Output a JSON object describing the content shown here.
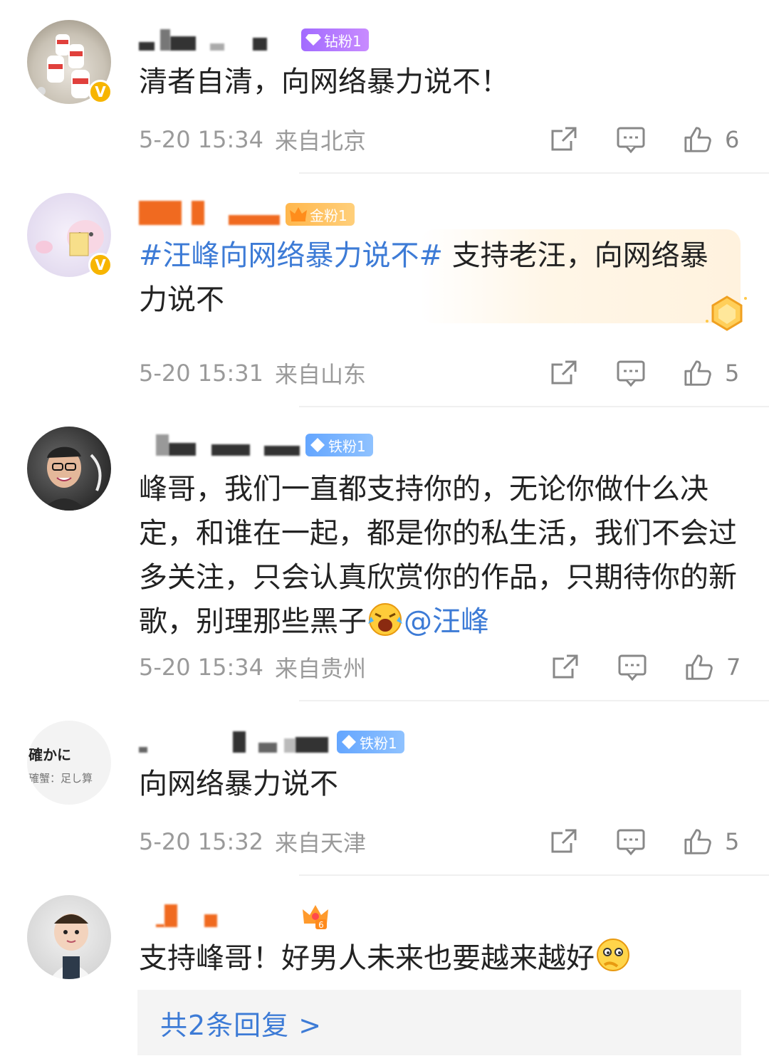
{
  "comments": [
    {
      "badge": "钻粉1",
      "text": "清者自清，向网络暴力说不！",
      "time": "5-20 15:34",
      "location": "来自北京",
      "likes": "6"
    },
    {
      "badge": "金粉1",
      "topic": "#汪峰向网络暴力说不#",
      "text": " 支持老汪，向网络暴力说不",
      "time": "5-20 15:31",
      "location": "来自山东",
      "likes": "5"
    },
    {
      "badge": "铁粉1",
      "text": "峰哥，我们一直都支持你的，无论你做什么决定，和谁在一起，都是你的私生活，我们不会过多关注，只会认真欣赏你的作品，只期待你的新歌，别理那些黑子",
      "mention": "@汪峰",
      "time": "5-20 15:34",
      "location": "来自贵州",
      "likes": "7"
    },
    {
      "badge": "铁粉1",
      "avatar_text_1": "確かに",
      "avatar_text_2": "確蟹：足し算",
      "text": "向网络暴力说不",
      "time": "5-20 15:32",
      "location": "来自天津",
      "likes": "5"
    },
    {
      "badge_level": "6",
      "text": "支持峰哥！好男人未来也要越来越好"
    }
  ],
  "replies_link": "共2条回复 >",
  "icons": [
    "share-icon",
    "comment-icon",
    "thumbs-up-icon",
    "verified-v-icon",
    "diamond-icon",
    "crown-icon",
    "laughing-emoji",
    "thinking-emoji"
  ],
  "colors": {
    "link": "#3d7bd6",
    "meta": "#9a9a9a",
    "verified": "#f7b500",
    "diamond_fan": "#b57dff",
    "gold_fan": "#ffbf5f",
    "iron_fan": "#74b0ff"
  }
}
